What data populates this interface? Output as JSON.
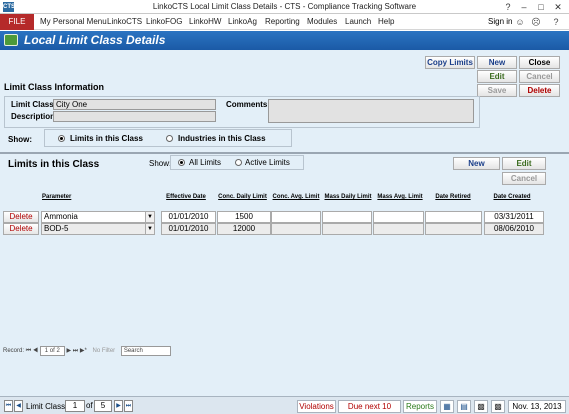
{
  "window": {
    "title": "LinkoCTS Local Limit Class Details - CTS - Compliance Tracking Software",
    "logo_text": "CTS"
  },
  "menu": {
    "file": "FILE",
    "items": [
      "My Personal Menu",
      "LinkoCTS",
      "LinkoFOG",
      "LinkoHW",
      "LinkoAg",
      "Reporting",
      "Modules",
      "Launch",
      "Help"
    ],
    "sign_in": "Sign in"
  },
  "banner": {
    "title": "Local Limit Class Details"
  },
  "toolbar": {
    "copy_limits": "Copy Limits",
    "new": "New",
    "close": "Close",
    "edit": "Edit",
    "cancel": "Cancel",
    "save": "Save",
    "delete": "Delete"
  },
  "info": {
    "heading": "Limit Class Information",
    "limit_class_label": "Limit Class:",
    "limit_class_value": "City One",
    "description_label": "Description:",
    "description_value": "",
    "comments_label": "Comments:",
    "comments_value": "",
    "show_label": "Show:",
    "option_limits": "Limits in this Class",
    "option_industries": "Industries in this Class"
  },
  "limits": {
    "heading": "Limits in this Class",
    "show_label": "Show:",
    "option_all": "All Limits",
    "option_active": "Active Limits",
    "new": "New",
    "edit": "Edit",
    "cancel": "Cancel",
    "columns": [
      "Parameter",
      "Effective Date",
      "Conc. Daily Limit",
      "Conc. Avg. Limit",
      "Mass Daily Limit",
      "Mass Avg. Limit",
      "Date Retired",
      "Date Created"
    ],
    "rows": [
      {
        "delete": "Delete",
        "parameter": "Ammonia",
        "effective": "01/01/2010",
        "conc_daily": "1500",
        "conc_avg": "",
        "mass_daily": "",
        "mass_avg": "",
        "retired": "",
        "created": "03/31/2011"
      },
      {
        "delete": "Delete",
        "parameter": "BOD-5",
        "effective": "01/01/2010",
        "conc_daily": "12000",
        "conc_avg": "",
        "mass_daily": "",
        "mass_avg": "",
        "retired": "",
        "created": "08/06/2010"
      }
    ]
  },
  "record_nav": {
    "label": "Record:",
    "position": "1 of 2",
    "filter": "No Filter",
    "search": "Search"
  },
  "footer": {
    "limit_class_label": "Limit Class:",
    "current": "1",
    "of_label": "of",
    "total": "5",
    "violations": "Violations",
    "due": "Due next 10 days",
    "reports": "Reports",
    "date": "Nov. 13, 2013"
  },
  "colors": {
    "file_tab": "#b52a2a",
    "banner": "#1b5aa6",
    "panel": "#e3eff8",
    "delete_red": "#b00000",
    "link_blue": "#1b3f8a"
  }
}
